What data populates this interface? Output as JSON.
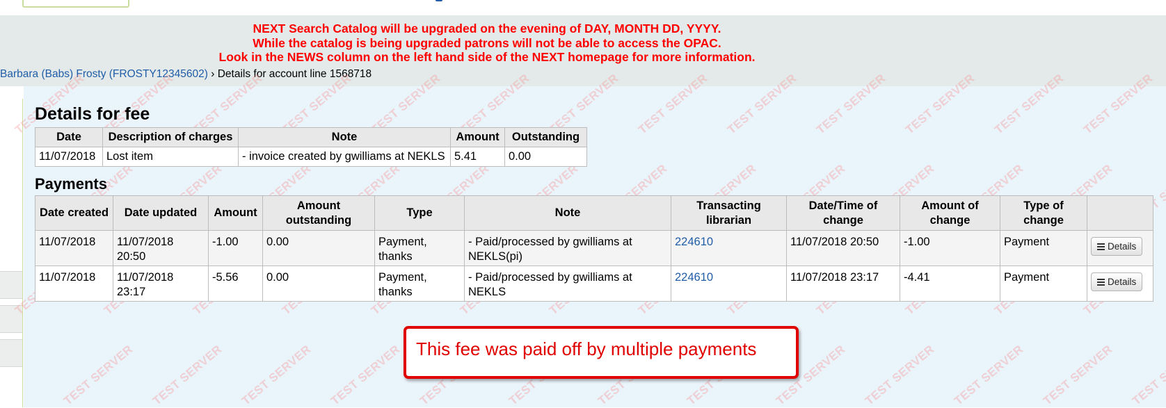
{
  "notice": {
    "lines": [
      "NEXT Search Catalog will be upgraded on the evening of DAY, MONTH DD, YYYY.",
      "While the catalog is being upgraded patrons will not be able to access the OPAC.",
      "Look in the NEWS column on the left hand side of the NEXT homepage for more information."
    ],
    "color": "#ff0000"
  },
  "breadcrumb": {
    "patron_link": "Barbara (Babs) Frosty (FROSTY12345602)",
    "separator": "›",
    "current": "Details for account line 1568718"
  },
  "watermark_text": "TEST SERVER",
  "fee_section": {
    "heading": "Details for fee",
    "columns": [
      "Date",
      "Description of charges",
      "Note",
      "Amount",
      "Outstanding"
    ],
    "rows": [
      [
        "11/07/2018",
        "Lost item",
        "- invoice created by gwilliams at NEKLS",
        "5.41",
        "0.00"
      ]
    ]
  },
  "payments_section": {
    "heading": "Payments",
    "columns": [
      "Date created",
      "Date updated",
      "Amount",
      "Amount outstanding",
      "Type",
      "Note",
      "Transacting librarian",
      "Date/Time of change",
      "Amount of change",
      "Type of change",
      ""
    ],
    "rows": [
      {
        "date_created": "11/07/2018",
        "date_updated": "11/07/2018 20:50",
        "amount": "-1.00",
        "amount_outstanding": "0.00",
        "type": "Payment, thanks",
        "note": "- Paid/processed by gwilliams at NEKLS(pi)",
        "librarian": "224610",
        "change_time": "11/07/2018 20:50",
        "change_amount": "-1.00",
        "change_type": "Payment",
        "button": "Details"
      },
      {
        "date_created": "11/07/2018",
        "date_updated": "11/07/2018 23:17",
        "amount": "-5.56",
        "amount_outstanding": "0.00",
        "type": "Payment, thanks",
        "note": "- Paid/processed by gwilliams at NEKLS",
        "librarian": "224610",
        "change_time": "11/07/2018 23:17",
        "change_amount": "-4.41",
        "change_type": "Payment",
        "button": "Details"
      }
    ]
  },
  "callout": {
    "text": "This fee was paid off by multiple payments",
    "color": "#e00000"
  },
  "colors": {
    "link": "#1f5da8",
    "main_background": "#eaf4fb",
    "banner_background": "#e4eaea"
  }
}
